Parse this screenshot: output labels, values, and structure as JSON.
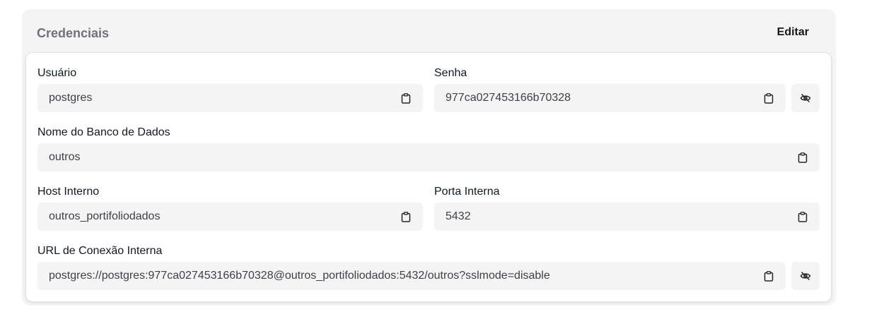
{
  "card": {
    "title": "Credenciais",
    "edit_label": "Editar"
  },
  "fields": {
    "user": {
      "label": "Usuário",
      "value": "postgres"
    },
    "password": {
      "label": "Senha",
      "value": "977ca027453166b70328"
    },
    "db_name": {
      "label": "Nome do Banco de Dados",
      "value": "outros"
    },
    "host": {
      "label": "Host Interno",
      "value": "outros_portifoliodados"
    },
    "port": {
      "label": "Porta Interna",
      "value": "5432"
    },
    "url": {
      "label": "URL de Conexão Interna",
      "value": "postgres://postgres:977ca027453166b70328@outros_portifoliodados:5432/outros?sslmode=disable"
    }
  },
  "icons": {
    "copy": "clipboard-icon",
    "toggle_visibility": "eye-off-icon"
  }
}
